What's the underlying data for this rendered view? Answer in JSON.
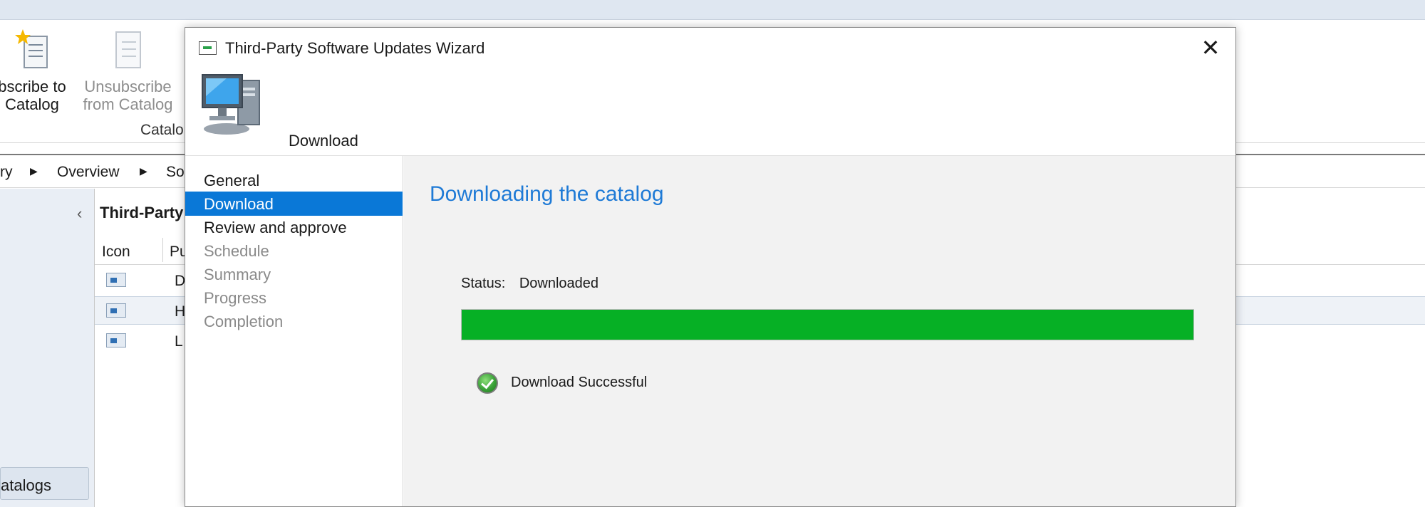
{
  "console": {
    "ribbon": {
      "subscribe_label": "bscribe to\nCatalog",
      "unsubscribe_label": "Unsubscribe\nfrom Catalog",
      "group_label": "Catalo"
    },
    "breadcrumb": [
      "ry",
      "Overview",
      "So"
    ],
    "list": {
      "title": "Third-Party",
      "columns": [
        "Icon",
        "Pu"
      ],
      "rows": [
        "D",
        "H",
        "L"
      ]
    },
    "nav_button": "atalogs"
  },
  "wizard": {
    "title": "Third-Party Software Updates Wizard",
    "page_header": "Download",
    "steps": [
      {
        "label": "General",
        "state": "normal"
      },
      {
        "label": "Download",
        "state": "active"
      },
      {
        "label": "Review and approve",
        "state": "normal"
      },
      {
        "label": "Schedule",
        "state": "disabled"
      },
      {
        "label": "Summary",
        "state": "disabled"
      },
      {
        "label": "Progress",
        "state": "disabled"
      },
      {
        "label": "Completion",
        "state": "disabled"
      }
    ],
    "content": {
      "heading": "Downloading the catalog",
      "status_label": "Status:",
      "status_value": "Downloaded",
      "progress_percent": 100,
      "result_text": "Download Successful"
    }
  },
  "colors": {
    "accent_blue": "#0a78d7",
    "heading_blue": "#1e7ad6",
    "progress_green": "#06b025"
  }
}
